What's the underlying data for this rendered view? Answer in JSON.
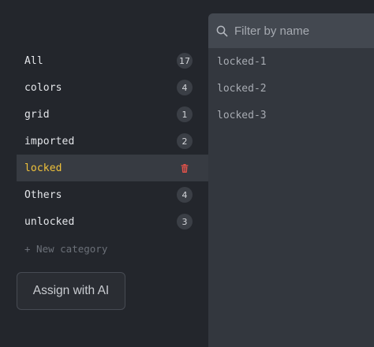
{
  "categories": [
    {
      "label": "All",
      "count": "17"
    },
    {
      "label": "colors",
      "count": "4"
    },
    {
      "label": "grid",
      "count": "1"
    },
    {
      "label": "imported",
      "count": "2"
    },
    {
      "label": "locked",
      "count": null,
      "selected": true
    },
    {
      "label": "Others",
      "count": "4"
    },
    {
      "label": "unlocked",
      "count": "3"
    }
  ],
  "new_category_label": "+ New category",
  "assign_button_label": "Assign with AI",
  "filter": {
    "placeholder": "Filter by name",
    "value": ""
  },
  "items": [
    "locked-1",
    "locked-2",
    "locked-3"
  ],
  "icons": {
    "search": "search-icon",
    "delete": "trash-icon"
  },
  "colors": {
    "selected_label": "#f0c23a",
    "delete_icon": "#e0524a"
  }
}
